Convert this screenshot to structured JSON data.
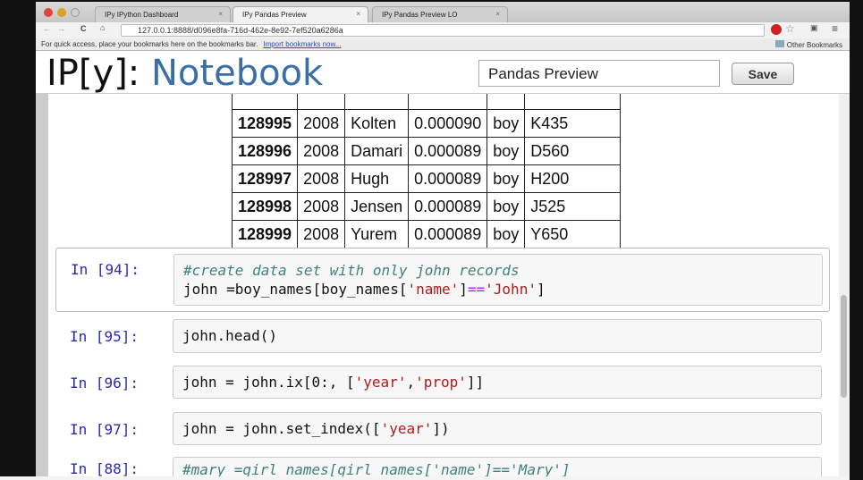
{
  "browser": {
    "tabs": [
      {
        "label": "IPy IPython Dashboard"
      },
      {
        "label": "IPy Pandas Preview"
      },
      {
        "label": "IPy Pandas Preview LO"
      }
    ],
    "url": "127.0.0.1:8888/d096e8fa-716d-462e-8e92-7ef520a6286a",
    "bookmarks_text": "For quick access, place your bookmarks here on the bookmarks bar.",
    "import_link": "Import bookmarks now...",
    "other_bookmarks": "Other Bookmarks"
  },
  "header": {
    "logo_prefix": "IP[y]:",
    "logo_suffix": "Notebook",
    "notebook_name": "Pandas Preview",
    "save_label": "Save"
  },
  "table": {
    "rows": [
      [
        "128995",
        "2008",
        "Kolten",
        "0.000090",
        "boy",
        "K435"
      ],
      [
        "128996",
        "2008",
        "Damari",
        "0.000089",
        "boy",
        "D560"
      ],
      [
        "128997",
        "2008",
        "Hugh",
        "0.000089",
        "boy",
        "H200"
      ],
      [
        "128998",
        "2008",
        "Jensen",
        "0.000089",
        "boy",
        "J525"
      ],
      [
        "128999",
        "2008",
        "Yurem",
        "0.000089",
        "boy",
        "Y650"
      ]
    ]
  },
  "cells": [
    {
      "prompt": "In [94]:",
      "line1": "#create data set with only john records",
      "l2a": "john =boy_names[boy_names[",
      "l2b": "'name'",
      "l2c": "]",
      "l2d": "==",
      "l2e": "'John'",
      "l2f": "]"
    },
    {
      "prompt": "In [95]:",
      "code": "john.head()"
    },
    {
      "prompt": "In [96]:",
      "a": "john = john.ix[0:, [",
      "b": "'year'",
      "c": ",",
      "d": "'prop'",
      "e": "]]"
    },
    {
      "prompt": "In [97]:",
      "a": "john = john.set_index([",
      "b": "'year'",
      "c": "])"
    },
    {
      "prompt": "In [88]:",
      "code": "#mary =girl_names[girl_names['name']=='Mary']"
    }
  ]
}
